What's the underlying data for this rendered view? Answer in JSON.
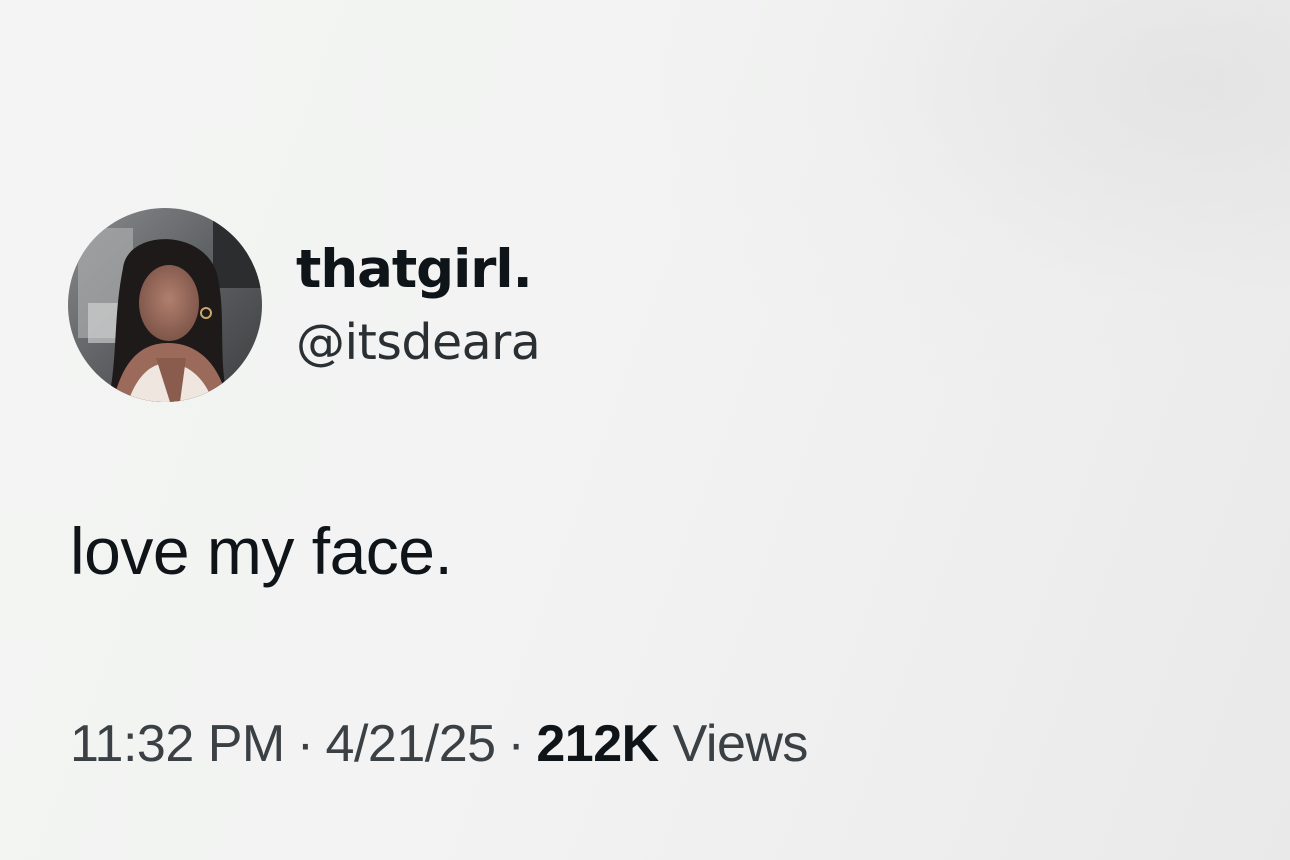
{
  "tweet": {
    "display_name": "thatgirl.",
    "handle": "@itsdeara",
    "text": "love my face.",
    "time": "11:32 PM",
    "separator": "·",
    "date": "4/21/25",
    "views_count": "212K",
    "views_label": "Views"
  },
  "icons": {
    "avatar": "profile-photo"
  },
  "colors": {
    "background": "#f2f3f2",
    "text_primary": "#0f1419",
    "text_secondary": "#3b4045"
  }
}
